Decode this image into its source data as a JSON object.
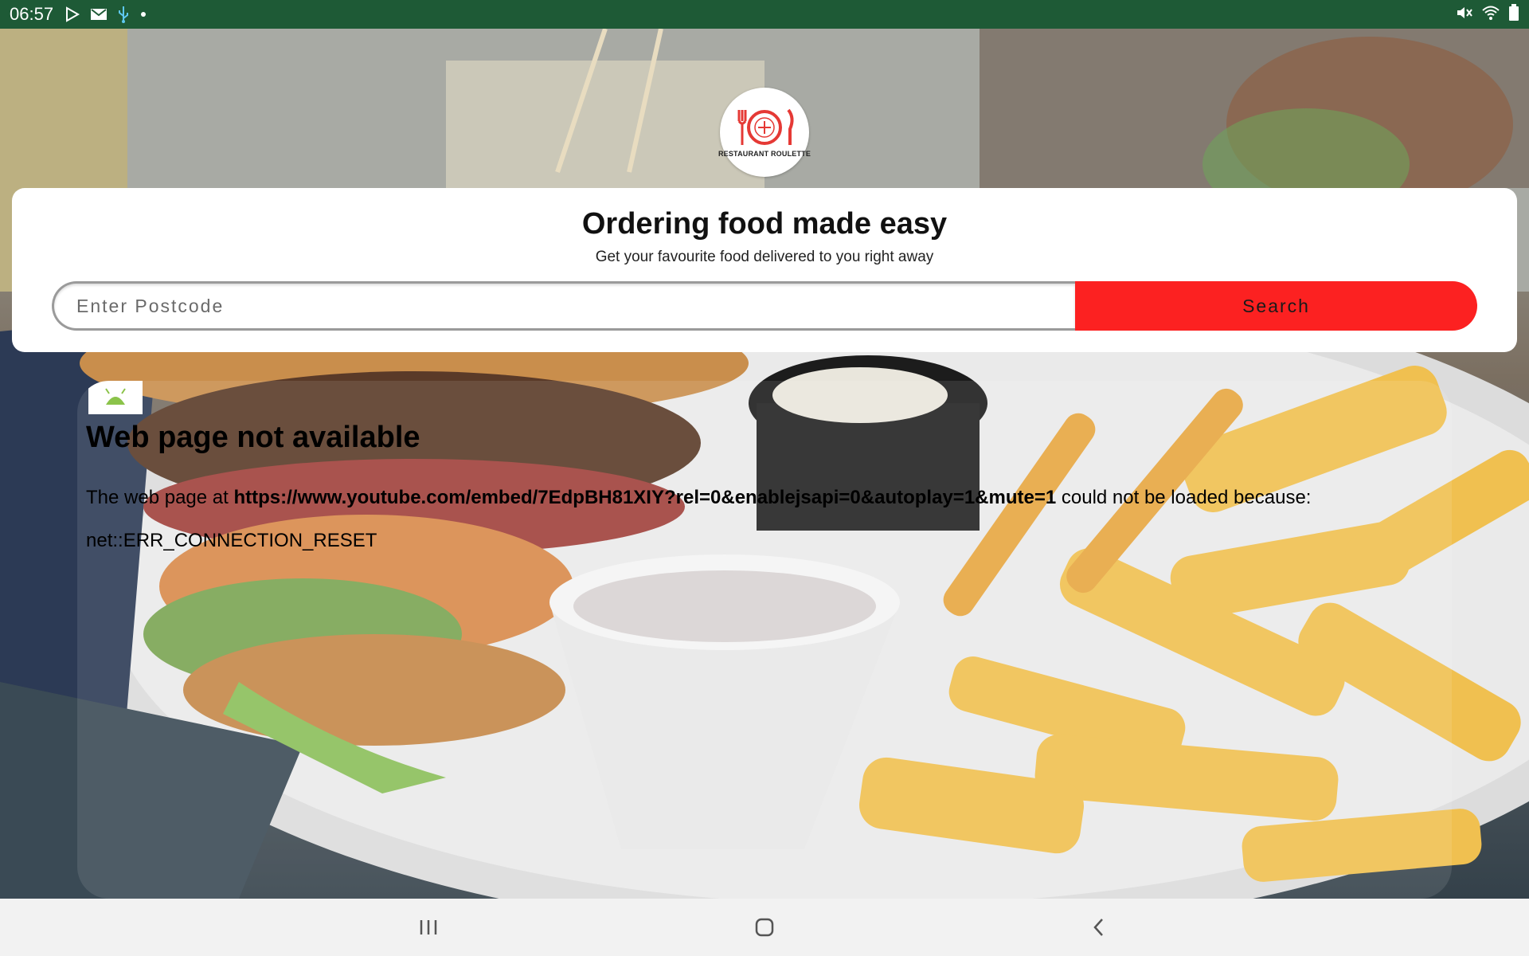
{
  "status_bar": {
    "time": "06:57",
    "left_icons": [
      "play-store-icon",
      "gmail-icon",
      "usb-icon",
      "dot-icon"
    ],
    "right_icons": [
      "mute-icon",
      "wifi-icon",
      "battery-icon"
    ]
  },
  "logo": {
    "text": "RESTAURANT ROULETTE",
    "accent_color": "#e53935"
  },
  "search_card": {
    "headline": "Ordering food made easy",
    "subline": "Get your favourite food delivered to you right away",
    "postcode_placeholder": "Enter Postcode",
    "postcode_value": "",
    "search_label": "Search",
    "button_color": "#fc2121"
  },
  "webview": {
    "error_title": "Web page not available",
    "body_prefix": "The web page at ",
    "url": "https://www.youtube.com/embed/7EdpBH81XIY?rel=0&enablejsapi=0&autoplay=1&mute=1",
    "body_suffix": " could not be loaded because:",
    "error_code": "net::ERR_CONNECTION_RESET"
  },
  "nav_bar": {
    "buttons": [
      "recent-apps",
      "home",
      "back"
    ]
  }
}
